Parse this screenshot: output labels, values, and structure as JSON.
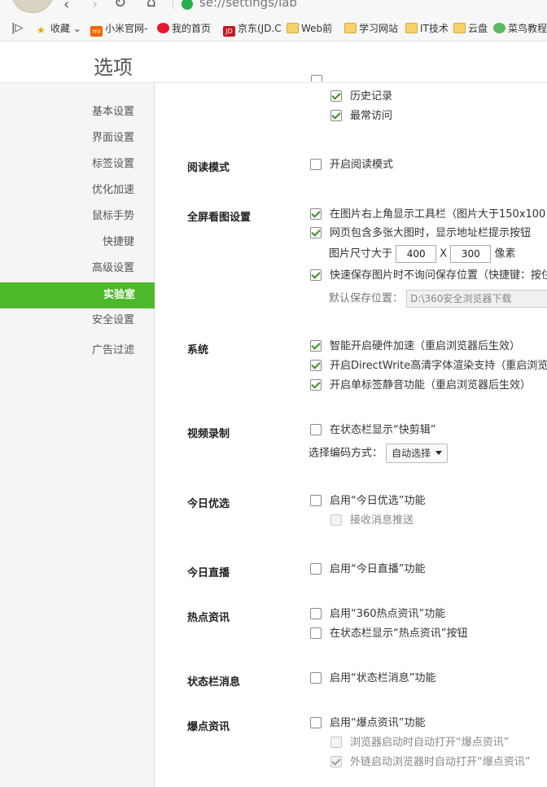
{
  "browser": {
    "url": "se://settings/lab",
    "bookmarks": [
      {
        "label": "收藏",
        "icon": "star-icon"
      },
      {
        "label": "小米官网-",
        "icon": "mi-icon"
      },
      {
        "label": "我的首页",
        "icon": "weibo-icon"
      },
      {
        "label": "京东(JD.C",
        "icon": "jd-icon"
      },
      {
        "label": "Web前",
        "icon": "folder-icon"
      },
      {
        "label": "学习网站",
        "icon": "folder-icon"
      },
      {
        "label": "IT技术",
        "icon": "folder-icon"
      },
      {
        "label": "云盘",
        "icon": "folder-icon"
      },
      {
        "label": "菜鸟教程",
        "icon": "runoob-icon"
      }
    ]
  },
  "page": {
    "title": "选项"
  },
  "sidebar": {
    "items": [
      "基本设置",
      "界面设置",
      "标签设置",
      "优化加速",
      "鼠标手势",
      "快捷键",
      "高级设置",
      "实验室",
      "安全设置",
      "广告过滤"
    ],
    "active_index": 7
  },
  "top_options": [
    "历史记录",
    "最常访问"
  ],
  "reading": {
    "label": "阅读模式",
    "option": "开启阅读模式"
  },
  "fullscreen": {
    "label": "全屏看图设置",
    "opt1": "在图片右上角显示工具栏（图片大于150x100",
    "opt2": "网页包含多张大图时，显示地址栏提示按钮",
    "size_prefix": "图片尺寸大于",
    "width": "400",
    "times": "X",
    "height": "300",
    "unit": "像素",
    "opt3": "快速保存图片时不询问保存位置（快捷键：按住",
    "save_label": "默认保存位置：",
    "save_path": "D:\\360安全浏览器下载"
  },
  "system": {
    "label": "系统",
    "opts": [
      "智能开启硬件加速（重启浏览器后生效）",
      "开启DirectWrite高清字体渲染支持（重启浏览",
      "开启单标签静音功能（重启浏览器后生效）"
    ]
  },
  "video": {
    "label": "视频录制",
    "opt": "在状态栏显示“快剪辑”",
    "codec_label": "选择编码方式：",
    "codec_value": "自动选择"
  },
  "today_pick": {
    "label": "今日优选",
    "opt": "启用“今日优选”功能",
    "sub": "接收消息推送"
  },
  "today_live": {
    "label": "今日直播",
    "opt": "启用“今日直播”功能"
  },
  "hot_news": {
    "label": "热点资讯",
    "opt1": "启用“360热点资讯”功能",
    "opt2": "在状态栏显示“热点资讯”按钮"
  },
  "statusbar_msg": {
    "label": "状态栏消息",
    "opt": "启用“状态栏消息”功能"
  },
  "burst_news": {
    "label": "爆点资讯",
    "opt": "启用“爆点资讯”功能",
    "sub1": "浏览器启动时自动打开“爆点资讯”",
    "sub2": "外链启动浏览器时自动打开“爆点资讯”"
  }
}
